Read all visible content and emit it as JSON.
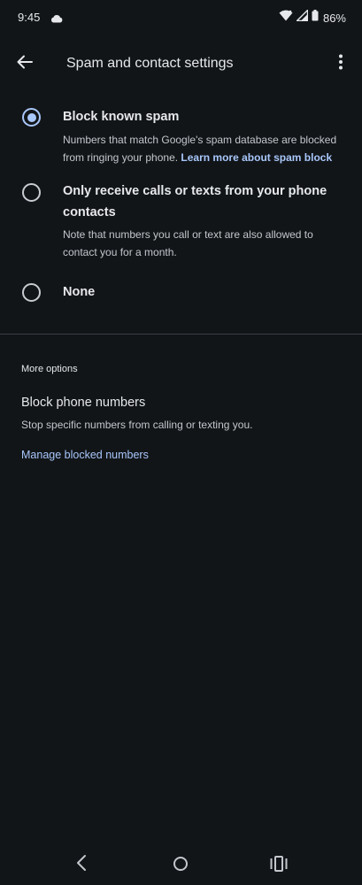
{
  "status_bar": {
    "time": "9:45",
    "battery": "86%",
    "icons": [
      "cloud-icon",
      "wifi-icon",
      "signal-icon",
      "battery-icon"
    ]
  },
  "app_bar": {
    "title": "Spam and contact settings",
    "back_icon": "arrow-back-icon",
    "menu_icon": "more-vert-icon"
  },
  "options": [
    {
      "title": "Block known spam",
      "description": "Numbers that match Google's spam database are blocked from ringing your phone.",
      "link": "Learn more about spam block",
      "selected": true
    },
    {
      "title": "Only receive calls or texts from your phone contacts",
      "description": "Note that numbers you call or text are also allowed to contact you for a month.",
      "selected": false
    },
    {
      "title": "None",
      "selected": false
    }
  ],
  "more_options": {
    "header": "More options",
    "block_title": "Block phone numbers",
    "block_description": "Stop specific numbers from calling or texting you.",
    "manage_link": "Manage blocked numbers"
  },
  "colors": {
    "background": "#121518",
    "accent": "#a8c7fa",
    "text_primary": "#e6e8eb",
    "text_secondary": "#c3c7cc"
  },
  "nav_bar": {
    "icons": [
      "nav-back-icon",
      "nav-home-icon",
      "nav-recents-icon"
    ]
  }
}
